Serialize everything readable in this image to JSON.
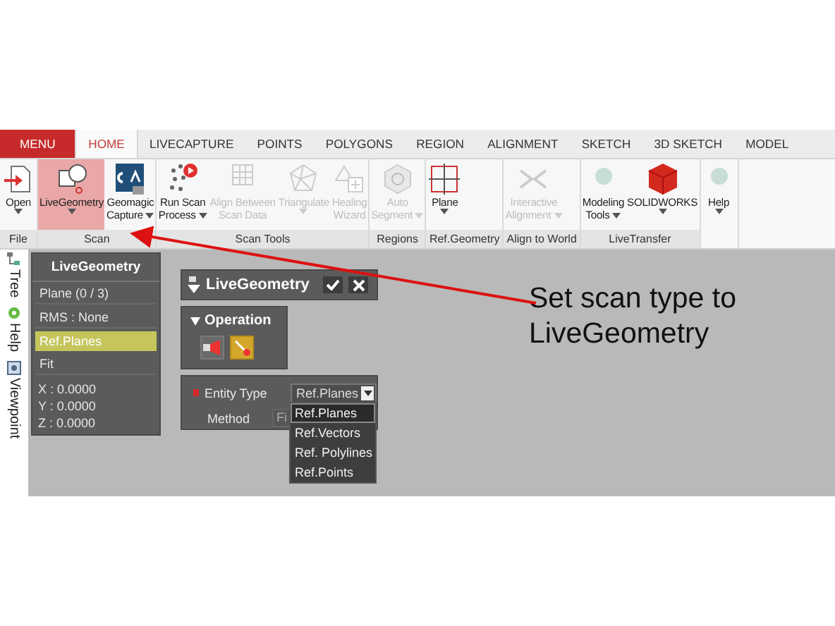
{
  "tabs": [
    {
      "label": "MENU",
      "kind": "menu",
      "selected": false
    },
    {
      "label": "HOME",
      "kind": "tab",
      "selected": true
    },
    {
      "label": "LIVECAPTURE",
      "kind": "tab",
      "selected": false
    },
    {
      "label": "POINTS",
      "kind": "tab",
      "selected": false
    },
    {
      "label": "POLYGONS",
      "kind": "tab",
      "selected": false
    },
    {
      "label": "REGION",
      "kind": "tab",
      "selected": false
    },
    {
      "label": "ALIGNMENT",
      "kind": "tab",
      "selected": false
    },
    {
      "label": "SKETCH",
      "kind": "tab",
      "selected": false
    },
    {
      "label": "3D SKETCH",
      "kind": "tab",
      "selected": false
    },
    {
      "label": "MODEL",
      "kind": "tab",
      "selected": false
    }
  ],
  "ribbon_groups": [
    {
      "label": "File",
      "buttons": [
        {
          "kind": "open",
          "lines": [
            "Open"
          ],
          "dropdown": true,
          "disabled": false,
          "selected": false
        }
      ]
    },
    {
      "label": "Scan",
      "buttons": [
        {
          "kind": "shapes",
          "lines": [
            "LiveGeometry"
          ],
          "dropdown": true,
          "disabled": false,
          "selected": true
        },
        {
          "kind": "app",
          "lines": [
            "Geomagic",
            "Capture"
          ],
          "dropdown": true,
          "disabled": false,
          "selected": false
        }
      ]
    },
    {
      "label": "Scan Tools",
      "buttons": [
        {
          "kind": "dots",
          "lines": [
            "Run Scan",
            "Process"
          ],
          "dropdown": true,
          "disabled": false,
          "selected": false
        },
        {
          "kind": "grid",
          "lines": [
            "Align Between",
            "Scan Data"
          ],
          "dropdown": false,
          "disabled": true,
          "selected": false
        },
        {
          "kind": "mesh",
          "lines": [
            "Triangulate"
          ],
          "dropdown": true,
          "disabled": true,
          "selected": false
        },
        {
          "kind": "heal",
          "lines": [
            "Healing",
            "Wizard"
          ],
          "dropdown": false,
          "disabled": true,
          "selected": false
        }
      ]
    },
    {
      "label": "Regions",
      "buttons": [
        {
          "kind": "segment",
          "lines": [
            "Auto",
            "Segment"
          ],
          "dropdown": true,
          "disabled": true,
          "selected": false
        }
      ]
    },
    {
      "label": "Ref.Geometry",
      "buttons": [
        {
          "kind": "plane",
          "lines": [
            "Plane"
          ],
          "dropdown": true,
          "disabled": false,
          "selected": false
        }
      ]
    },
    {
      "label": "Align to World",
      "buttons": [
        {
          "kind": "align",
          "lines": [
            "Interactive",
            "Alignment"
          ],
          "dropdown": true,
          "disabled": true,
          "selected": false
        }
      ]
    },
    {
      "label": "LiveTransfer",
      "buttons": [
        {
          "kind": "dot",
          "lines": [
            "Modeling",
            "Tools"
          ],
          "dropdown": true,
          "disabled": false,
          "selected": false
        },
        {
          "kind": "cube",
          "lines": [
            "SOLIDWORKS"
          ],
          "dropdown": true,
          "disabled": false,
          "selected": false
        }
      ]
    },
    {
      "buttons": [
        {
          "kind": "dot",
          "lines": [
            "Help"
          ],
          "dropdown": true,
          "disabled": false,
          "selected": false
        }
      ]
    }
  ],
  "side_tabs": [
    {
      "label": "Tree",
      "kind": "tree"
    },
    {
      "label": "Help",
      "kind": "help"
    },
    {
      "label": "Viewpoint",
      "kind": "view"
    }
  ],
  "live_panel": {
    "title": "LiveGeometry",
    "items": [
      {
        "label": "Plane  (0 / 3)",
        "selected": false
      },
      {
        "label": "RMS : None",
        "selected": false
      },
      {
        "label": "Ref.Planes",
        "selected": true
      },
      {
        "label": "Fit",
        "selected": false
      }
    ],
    "coords": [
      "X : 0.0000",
      "Y : 0.0000",
      "Z : 0.0000"
    ]
  },
  "dialog": {
    "title": "LiveGeometry",
    "operation": {
      "title": "Operation",
      "tools": [
        {
          "kind": "erase",
          "selected": false
        },
        {
          "kind": "pick",
          "selected": true
        }
      ]
    },
    "entity_type": {
      "label": "Entity Type",
      "required": true,
      "value": "Ref.Planes",
      "options": [
        {
          "label": "Ref.Planes",
          "selected": true
        },
        {
          "label": "Ref.Vectors",
          "selected": false
        },
        {
          "label": "Ref. Polylines",
          "selected": false
        },
        {
          "label": "Ref.Points",
          "selected": false
        }
      ]
    },
    "method": {
      "label": "Method",
      "value": "Fi"
    }
  },
  "annotation": {
    "text": "Set scan type to LiveGeometry"
  }
}
